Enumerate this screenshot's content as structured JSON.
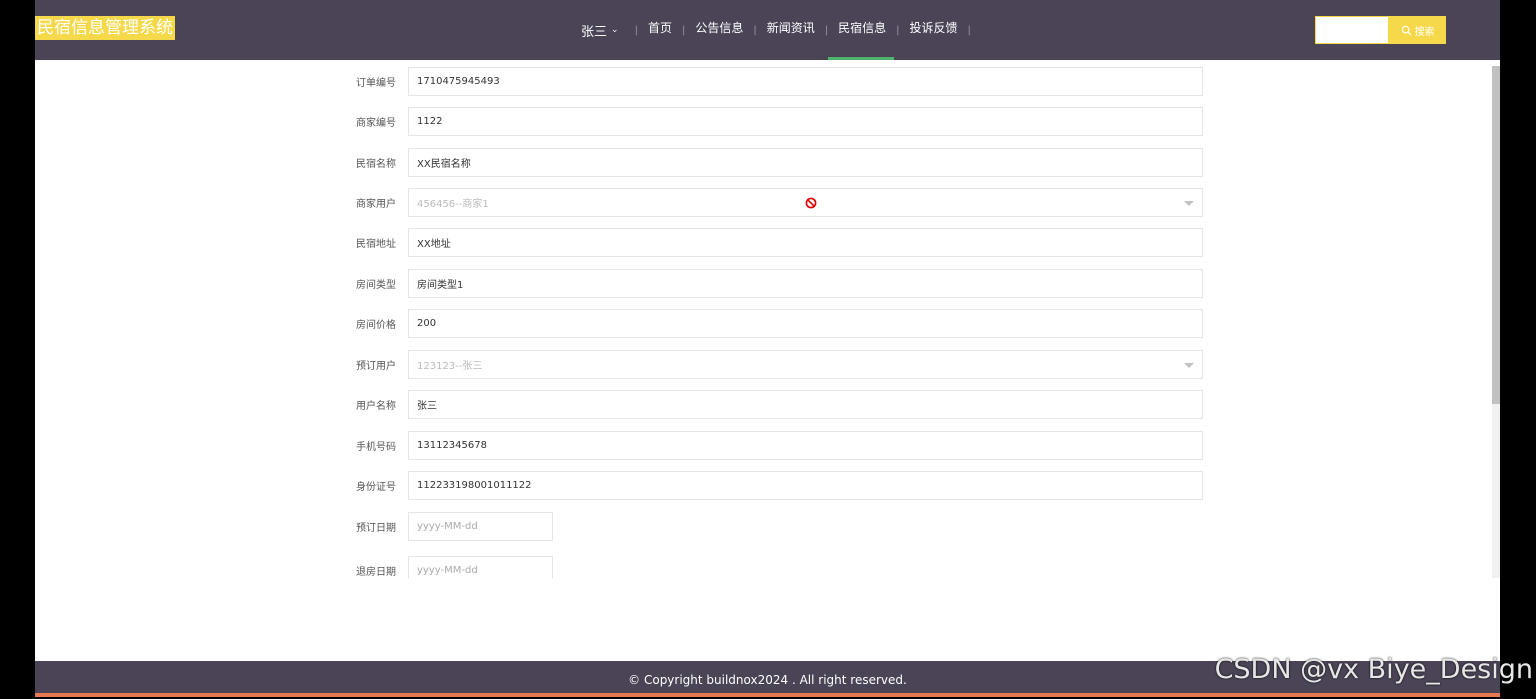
{
  "header": {
    "logo": "民宿信息管理系统",
    "user": "张三",
    "nav": [
      "首页",
      "公告信息",
      "新闻资讯",
      "民宿信息",
      "投诉反馈"
    ],
    "active_nav": "民宿信息",
    "search_placeholder": "",
    "search_label": "搜索"
  },
  "form": {
    "fields": [
      {
        "label": "订单编号",
        "value": "1710475945493"
      },
      {
        "label": "商家编号",
        "value": "1122"
      },
      {
        "label": "民宿名称",
        "value": "XX民宿名称"
      },
      {
        "label": "商家用户",
        "value": "456456--商家1"
      },
      {
        "label": "民宿地址",
        "value": "XX地址"
      },
      {
        "label": "房间类型",
        "value": "房间类型1"
      },
      {
        "label": "房间价格",
        "value": "200"
      },
      {
        "label": "预订用户",
        "value": "123123--张三"
      },
      {
        "label": "用户名称",
        "value": "张三"
      },
      {
        "label": "手机号码",
        "value": "13112345678"
      },
      {
        "label": "身份证号",
        "value": "112233198001011122"
      },
      {
        "label": "预订日期",
        "placeholder": "yyyy-MM-dd"
      },
      {
        "label": "退房日期",
        "placeholder": "yyyy-MM-dd"
      }
    ]
  },
  "footer": {
    "copyright": "© Copyright buildnox2024 . All right reserved."
  },
  "watermark": "CSDN @vx  Biye_Design"
}
